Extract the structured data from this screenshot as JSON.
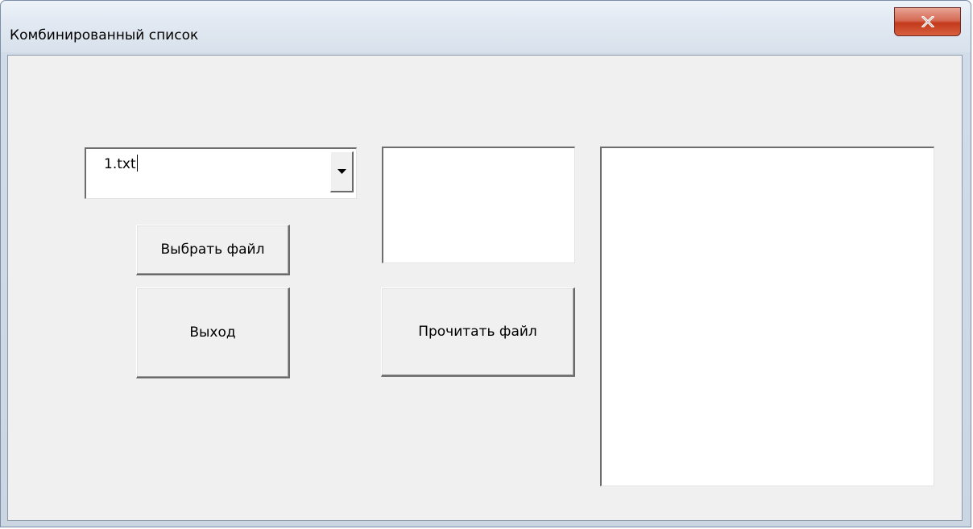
{
  "window": {
    "title": "Комбинированный список",
    "close_icon": "close-x-icon",
    "close_color": "#c4391c"
  },
  "form": {
    "combo": {
      "value": "1.txt",
      "arrow_icon": "dropdown-arrow-icon"
    },
    "buttons": {
      "select_file": "Выбрать файл",
      "exit": "Выход",
      "read_file": "Прочитать файл"
    },
    "textbox_small": {
      "value": ""
    },
    "textbox_large": {
      "value": ""
    }
  }
}
